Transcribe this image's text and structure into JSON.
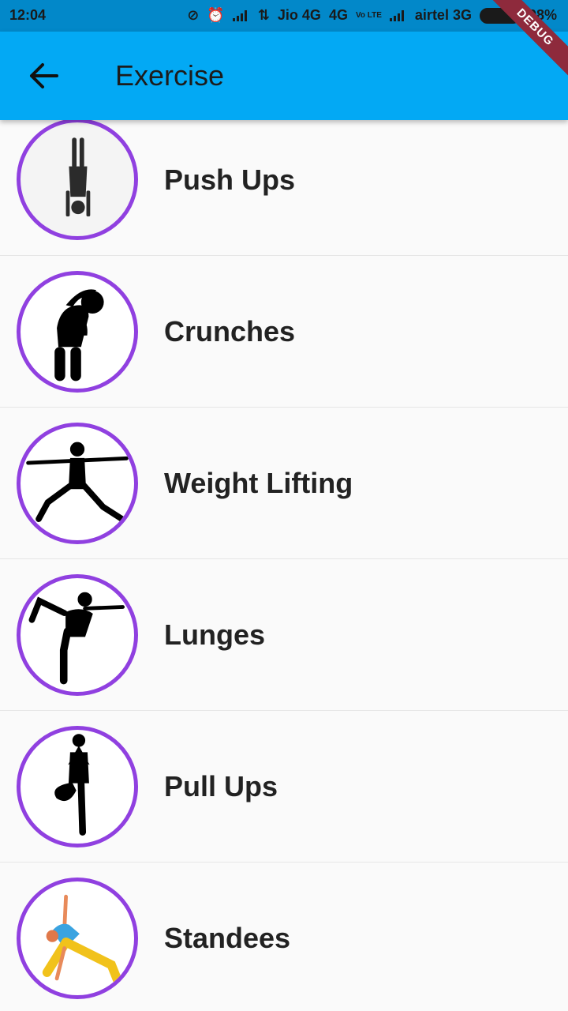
{
  "status_bar": {
    "time": "12:04",
    "carrier1": "Jio 4G",
    "net1": "4G",
    "volte": "Vo LTE",
    "carrier2": "airtel 3G",
    "battery": "98%"
  },
  "app_bar": {
    "title": "Exercise",
    "back_icon": "arrow-back-icon",
    "color": "#03a9f4"
  },
  "debug_banner": "DEBUG",
  "exercises": [
    {
      "label": "Push Ups",
      "icon": "handstand-icon"
    },
    {
      "label": "Crunches",
      "icon": "side-bend-icon"
    },
    {
      "label": "Weight Lifting",
      "icon": "warrior-pose-icon"
    },
    {
      "label": "Lunges",
      "icon": "dancer-pose-icon"
    },
    {
      "label": "Pull Ups",
      "icon": "tree-pose-icon"
    },
    {
      "label": "Standees",
      "icon": "triangle-pose-icon"
    }
  ],
  "colors": {
    "avatar_border": "#9040e0",
    "status_bar": "#0288c9"
  }
}
